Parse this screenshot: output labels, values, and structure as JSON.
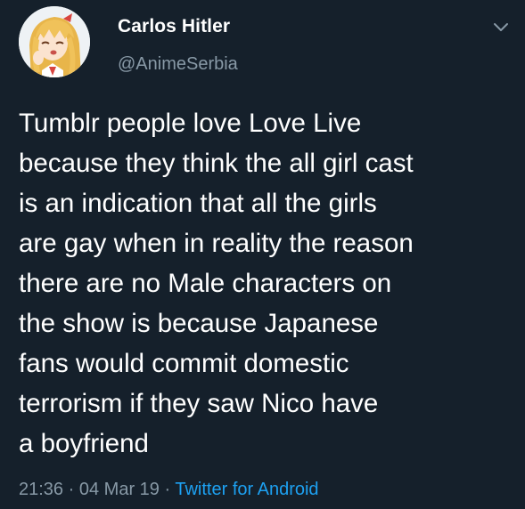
{
  "author": {
    "display_name": "Carlos Hitler",
    "handle": "@AnimeSerbia"
  },
  "tweet": {
    "lines": [
      "Tumblr people love Love Live",
      "because they think the all girl cast",
      "is an indication that all the girls",
      "are gay when in reality the reason",
      "there are no Male characters on",
      "the show is because Japanese",
      "fans would commit domestic",
      "terrorism if they saw Nico have",
      "a boyfriend"
    ]
  },
  "meta": {
    "time": "21:36",
    "separator": "·",
    "date": "04 Mar 19",
    "source": "Twitter for Android"
  },
  "icons": {
    "menu": "chevron-down-icon",
    "avatar": "anime-girl-avatar"
  },
  "colors": {
    "background": "#15202b",
    "text": "#ffffff",
    "secondary_text": "#8899a6",
    "link": "#1da1f2"
  }
}
